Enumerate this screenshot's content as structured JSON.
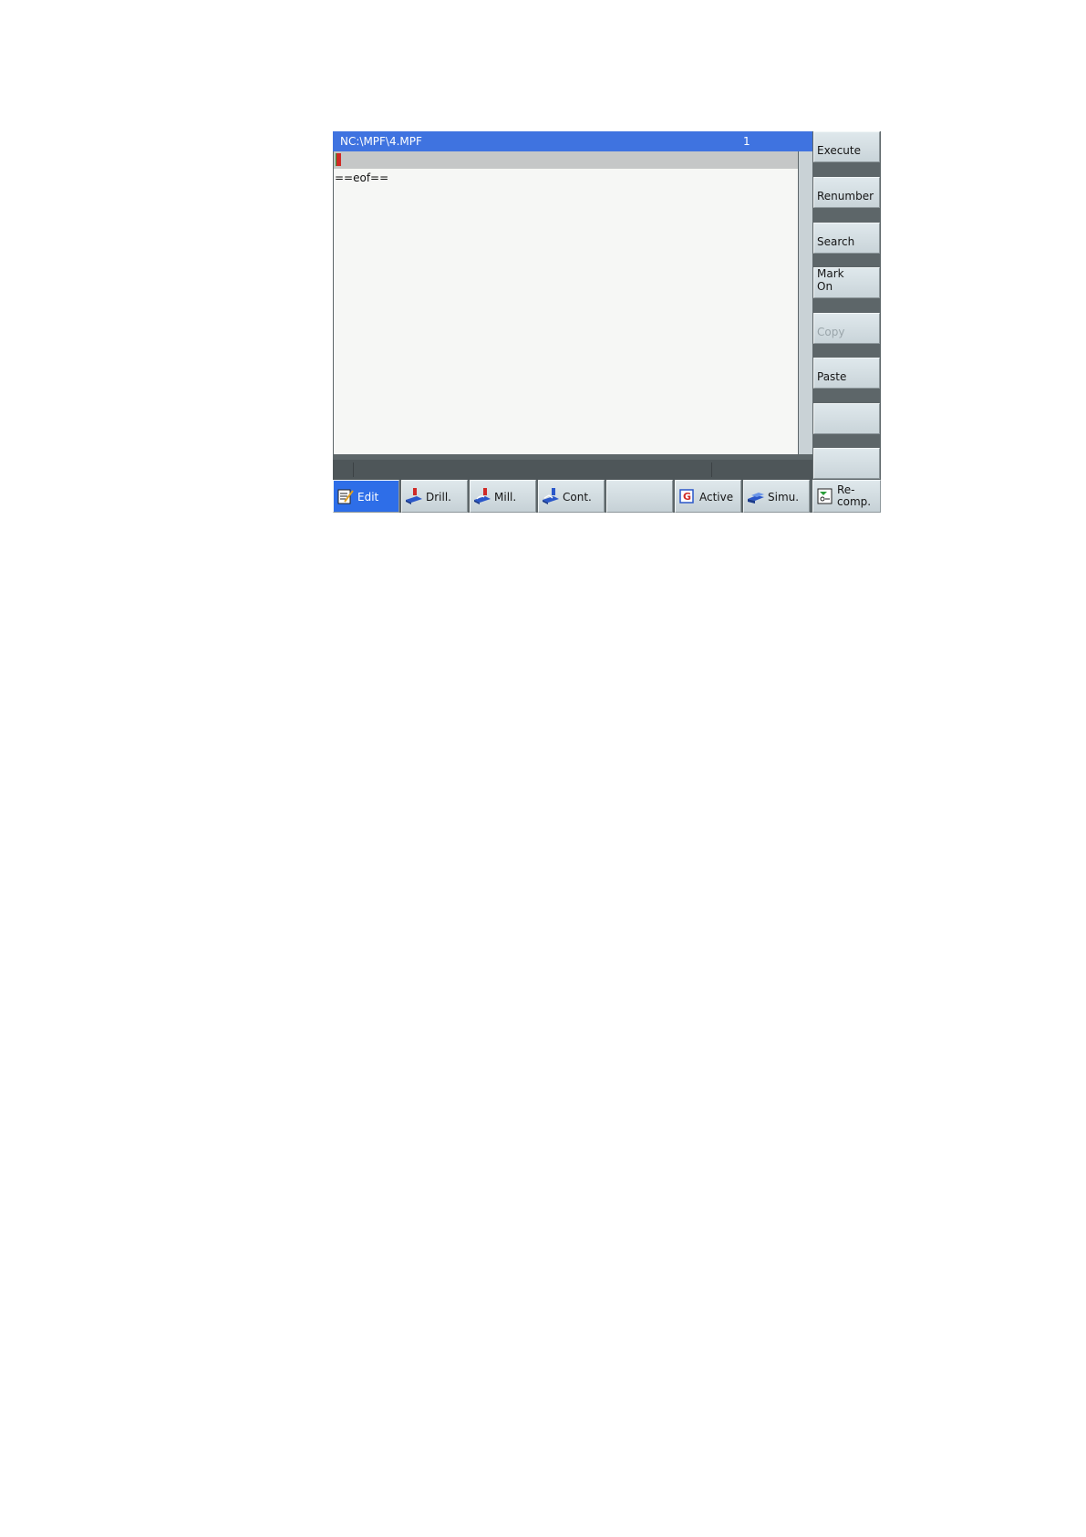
{
  "window": {
    "path": "NC:\\MPF\\4.MPF",
    "line": "1"
  },
  "editor": {
    "eof_marker": "==eof=="
  },
  "vertical_softkeys": [
    {
      "label": "Execute",
      "enabled": true
    },
    {
      "label": "Renumber",
      "enabled": true
    },
    {
      "label": "Search",
      "enabled": true
    },
    {
      "label": "Mark\nOn",
      "enabled": true
    },
    {
      "label": "Copy",
      "enabled": false
    },
    {
      "label": "Paste",
      "enabled": true
    },
    {
      "label": "",
      "enabled": true
    },
    {
      "label": "",
      "enabled": true
    }
  ],
  "horizontal_softkeys": [
    {
      "label": "Edit",
      "icon": "edit-icon",
      "active": true
    },
    {
      "label": "Drill.",
      "icon": "drill-icon",
      "active": false
    },
    {
      "label": "Mill.",
      "icon": "mill-icon",
      "active": false
    },
    {
      "label": "Cont.",
      "icon": "contour-icon",
      "active": false
    },
    {
      "label": "",
      "icon": "",
      "active": false
    },
    {
      "label": "Active",
      "icon": "g-code-icon",
      "active": false
    },
    {
      "label": "Simu.",
      "icon": "simulation-icon",
      "active": false
    },
    {
      "label": "Re-\ncomp.",
      "icon": "recompile-icon",
      "active": false
    }
  ],
  "colors": {
    "title_bar": "#3f73e0",
    "active_key": "#2e6ee8",
    "frame": "#5d6669"
  }
}
